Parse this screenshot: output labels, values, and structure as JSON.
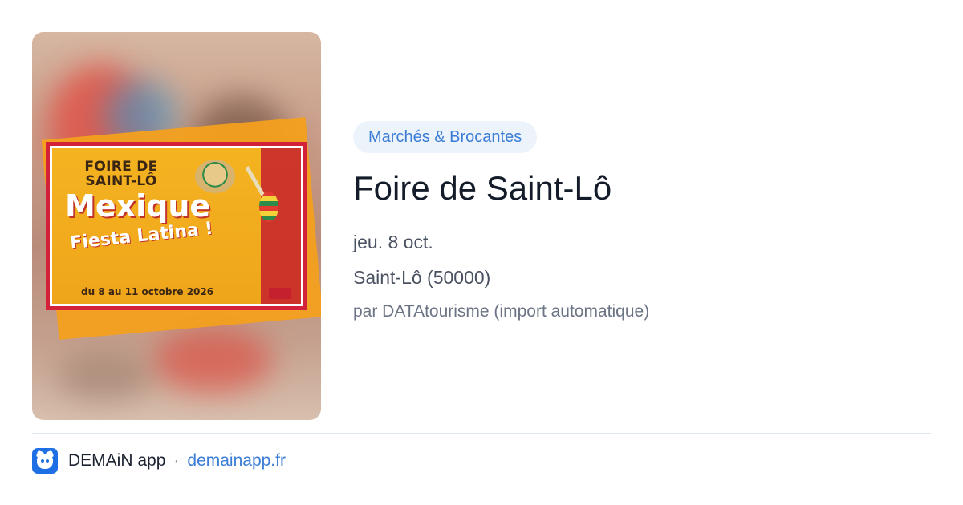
{
  "event": {
    "category": "Marchés & Brocantes",
    "title": "Foire de Saint-Lô",
    "date": "jeu. 8 oct.",
    "location": "Saint-Lô (50000)",
    "source": "par DATAtourisme (import automatique)"
  },
  "poster": {
    "line1": "FOIRE DE",
    "line2": "SAINT-LÔ",
    "headline": "Mexique",
    "subline": "Fiesta Latina !",
    "dates": "du 8 au 11 octobre 2026",
    "colors": {
      "frame": "#d3213a",
      "background": "#f4b321"
    }
  },
  "footer": {
    "app_icon": "demain-app-icon",
    "app_name": "DEMAiN app",
    "separator": "·",
    "domain": "demainapp.fr"
  },
  "colors": {
    "accent": "#3b7dd6",
    "tag_background": "#edf3fb",
    "title": "#141c2a",
    "meta": "#4a5262"
  }
}
